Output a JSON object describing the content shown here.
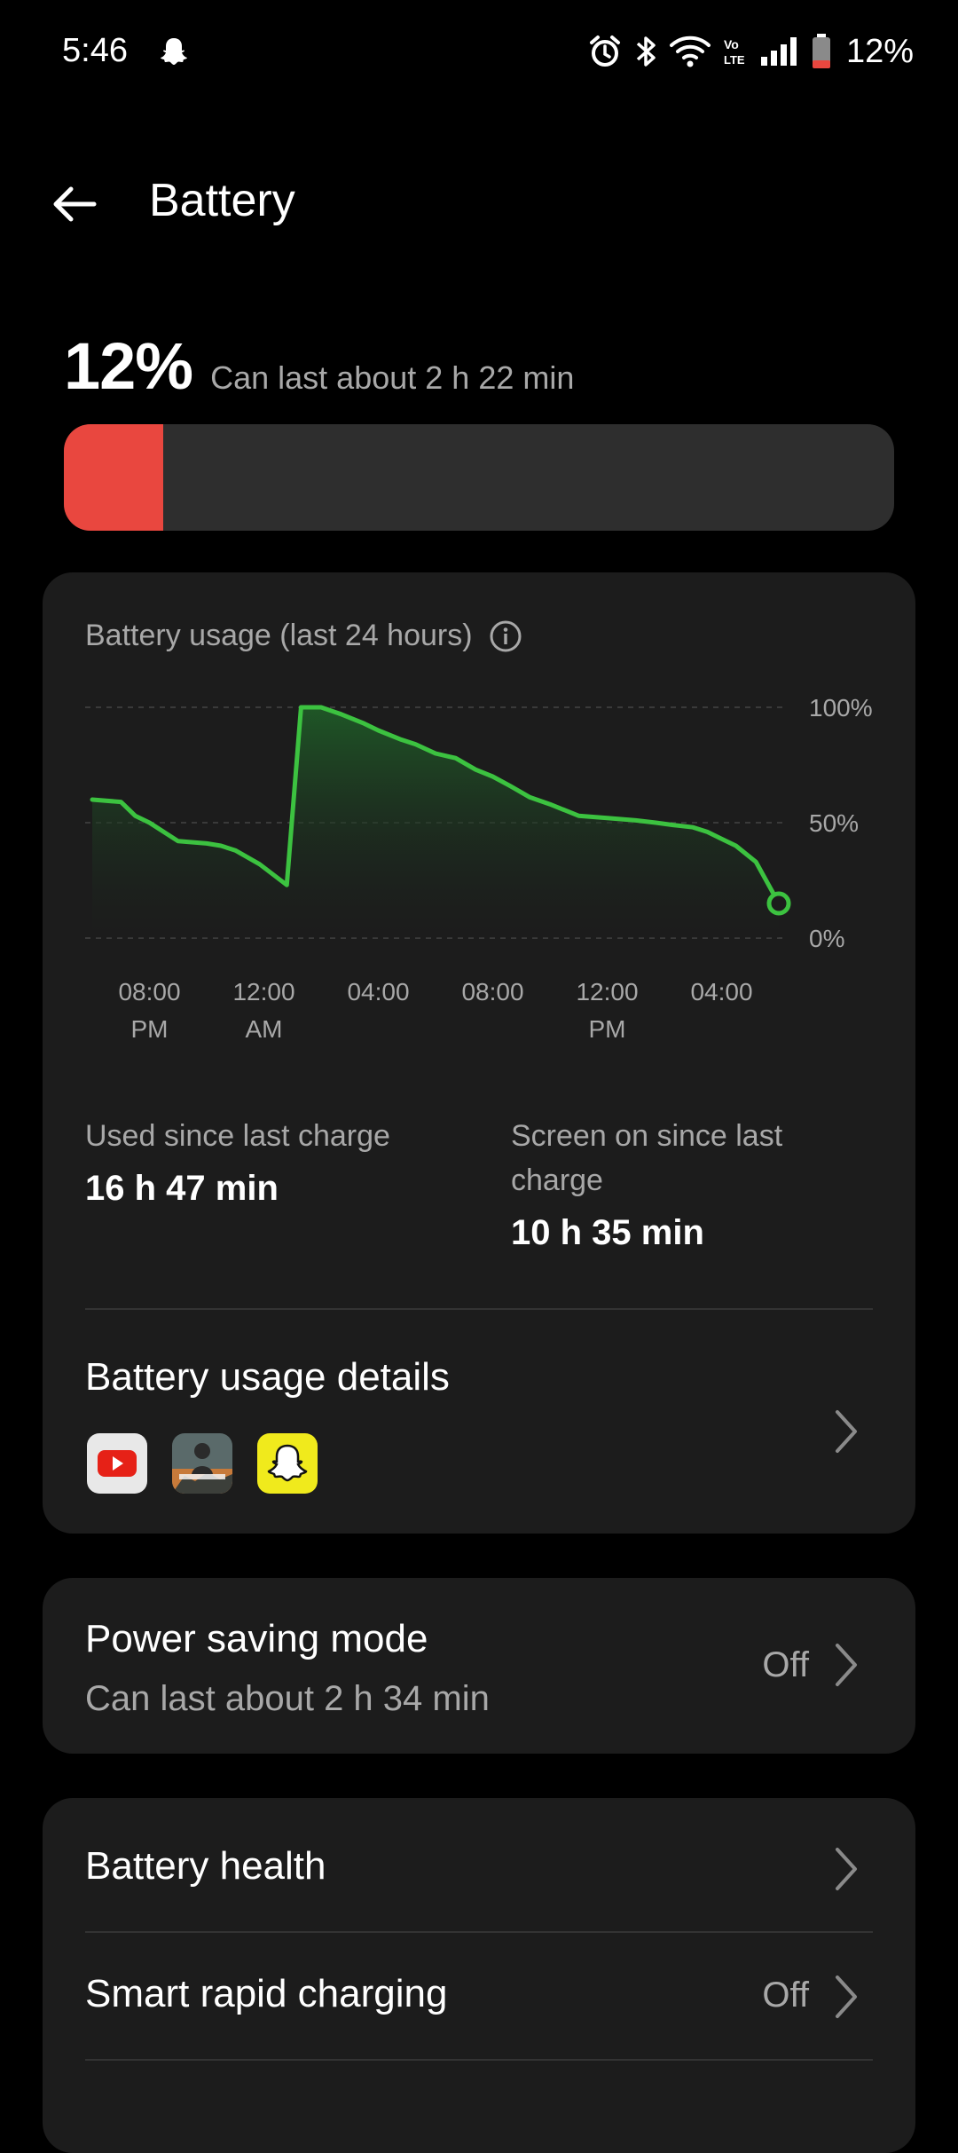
{
  "status_bar": {
    "time": "5:46",
    "battery_percent": "12%",
    "icons": [
      "snapchat-ghost-icon",
      "alarm-icon",
      "bluetooth-icon",
      "wifi-icon",
      "volte-icon",
      "signal-icon",
      "battery-icon"
    ],
    "battery_low_color": "#e9473f"
  },
  "header": {
    "title": "Battery",
    "back_icon": "arrow-left-icon"
  },
  "battery": {
    "percent": "12%",
    "percent_value": 0.12,
    "estimate": "Can last about 2 h 22 min",
    "bar_color": "#e9473f"
  },
  "usage": {
    "title": "Battery usage (last 24 hours)",
    "used_label": "Used since last charge",
    "used_value": "16 h 47 min",
    "screen_label": "Screen on since last charge",
    "screen_value": "10 h 35 min",
    "details_title": "Battery usage details",
    "apps": [
      "youtube-icon",
      "bgmi-icon",
      "snapchat-icon"
    ]
  },
  "chart_data": {
    "type": "area",
    "y_ticks": [
      "100%",
      "50%",
      "0%"
    ],
    "ylim": [
      0,
      100
    ],
    "x_ticks": [
      {
        "line1": "08:00",
        "line2": "PM",
        "hour": 2
      },
      {
        "line1": "12:00",
        "line2": "AM",
        "hour": 6
      },
      {
        "line1": "04:00",
        "line2": "",
        "hour": 10
      },
      {
        "line1": "08:00",
        "line2": "",
        "hour": 14
      },
      {
        "line1": "12:00",
        "line2": "PM",
        "hour": 18
      },
      {
        "line1": "04:00",
        "line2": "",
        "hour": 22
      }
    ],
    "series": [
      {
        "x": [
          0.0,
          1.0,
          1.5,
          2.0,
          3.0,
          4.0,
          4.5,
          5.0,
          5.85,
          6.8,
          7.3,
          8.0,
          8.7,
          9.5,
          10.0,
          10.8,
          11.3,
          12.0,
          12.7,
          13.4,
          14.0,
          14.6,
          15.3,
          16.0,
          17.0,
          18.0,
          19.0,
          19.7,
          20.3,
          21.0,
          21.5,
          22.0,
          22.5,
          23.2,
          24.0
        ],
        "y": [
          60,
          59,
          53,
          50,
          42,
          41,
          40,
          38,
          32,
          23,
          100,
          100,
          97,
          93,
          90,
          86,
          84,
          80,
          78,
          73,
          70,
          66,
          61,
          58,
          53,
          52,
          51,
          50,
          49,
          48,
          46,
          43,
          40,
          33,
          15
        ]
      }
    ],
    "line_color": "#3cc240",
    "grid": true
  },
  "power_saving": {
    "title": "Power saving mode",
    "subtitle": "Can last about 2 h 34 min",
    "value": "Off"
  },
  "list": {
    "battery_health": "Battery health",
    "smart_rapid_charging": "Smart rapid charging",
    "smart_rapid_value": "Off"
  },
  "colors": {
    "background": "#000000",
    "card": "#1c1c1c",
    "secondary_text": "#a8a8a8",
    "accent_green": "#3cc240"
  }
}
